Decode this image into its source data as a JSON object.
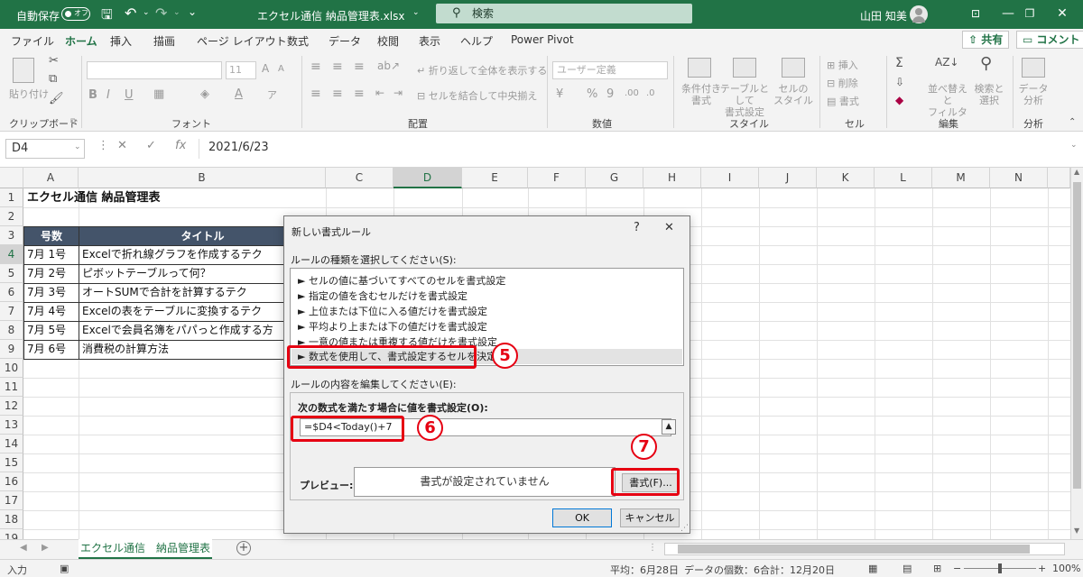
{
  "titlebar": {
    "autosave": "自動保存",
    "autosave_state": "オフ",
    "filename": "エクセル通信 納品管理表.xlsx",
    "search_placeholder": "検索",
    "user": "山田 知美"
  },
  "tabs": [
    "ファイル",
    "ホーム",
    "挿入",
    "描画",
    "ページ レイアウト",
    "数式",
    "データ",
    "校閲",
    "表示",
    "ヘルプ",
    "Power Pivot"
  ],
  "share_label": "共有",
  "comment_label": "コメント",
  "ribbon": {
    "paste": "貼り付け",
    "font_size": "11",
    "wrap_text": "折り返して全体を表示する",
    "merge_center": "セルを結合して中央揃え",
    "number_format": "ユーザー定義",
    "cond_format": "条件付き\n書式",
    "table_format": "テーブルとして\n書式設定",
    "cell_style": "セルの\nスタイル",
    "insert": "挿入",
    "delete": "削除",
    "format": "書式",
    "sort_filter": "並べ替えと\nフィルター",
    "find_select": "検索と\n選択",
    "data_analysis": "データ\n分析",
    "groups": {
      "clipboard": "クリップボード",
      "font": "フォント",
      "alignment": "配置",
      "number": "数値",
      "styles": "スタイル",
      "cells": "セル",
      "editing": "編集",
      "analysis": "分析"
    }
  },
  "formula_bar": {
    "name_box": "D4",
    "value": "2021/6/23"
  },
  "columns": [
    "A",
    "B",
    "C",
    "D",
    "E",
    "F",
    "G",
    "H",
    "I",
    "J",
    "K",
    "L",
    "M",
    "N"
  ],
  "rows": [
    "1",
    "2",
    "3",
    "4",
    "5",
    "6",
    "7",
    "8",
    "9",
    "10",
    "11",
    "12",
    "13",
    "14",
    "15",
    "16",
    "17",
    "18",
    "19"
  ],
  "table": {
    "title": "エクセル通信 納品管理表",
    "headers": [
      "号数",
      "タイトル"
    ],
    "rows": [
      [
        "7月 1号",
        "Excelで折れ線グラフを作成するテク"
      ],
      [
        "7月 2号",
        "ピボットテーブルって何？"
      ],
      [
        "7月 3号",
        "オートSUMで合計を計算するテク"
      ],
      [
        "7月 4号",
        "Excelの表をテーブルに変換するテク"
      ],
      [
        "7月 5号",
        "Excelで会員名簿をパパっと作成する方"
      ],
      [
        "7月 6号",
        "消費税の計算方法"
      ]
    ]
  },
  "sheet_tab": "エクセル通信　納品管理表",
  "status": {
    "mode": "入力",
    "average": "平均：6月28日",
    "count": "データの個数：6",
    "sum": "合計：12月20日",
    "zoom": "100%"
  },
  "dialog": {
    "title": "新しい書式ルール",
    "help": "?",
    "close": "✕",
    "select_type_label": "ルールの種類を選択してください(S):",
    "rule_types": [
      "セルの値に基づいてすべてのセルを書式設定",
      "指定の値を含むセルだけを書式設定",
      "上位または下位に入る値だけを書式設定",
      "平均より上または下の値だけを書式設定",
      "一意の値または重複する値だけを書式設定",
      "数式を使用して、書式設定するセルを決定"
    ],
    "edit_label": "ルールの内容を編集してください(E):",
    "formula_label": "次の数式を満たす場合に値を書式設定(O):",
    "formula": "=$D4<Today()+7",
    "preview_label": "プレビュー:",
    "preview_text": "書式が設定されていません",
    "format_button": "書式(F)...",
    "ok": "OK",
    "cancel": "キャンセル"
  },
  "callouts": [
    "5",
    "6",
    "7"
  ],
  "colors": {
    "excel_green": "#217346",
    "table_header": "#44546a",
    "callout_red": "#e60012"
  }
}
